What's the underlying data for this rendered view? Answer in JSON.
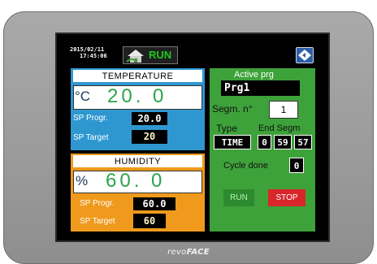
{
  "header": {
    "date": "2015/02/11",
    "time": "17:45:06",
    "status": "RUN",
    "colors": {
      "status": "#1ec81e",
      "nav": "#2d5ea8"
    }
  },
  "temperature": {
    "title": "TEMPERATURE",
    "unit": "°C",
    "value": "20. 0",
    "sp_progr_label": "SP Progr.",
    "sp_progr_value": "20.0",
    "sp_target_label": "SP Target",
    "sp_target_value": "20",
    "colors": {
      "panel": "#2f97d0",
      "value": "#2aa44a"
    }
  },
  "humidity": {
    "title": "HUMIDITY",
    "unit": "%",
    "value": "60. 0",
    "sp_progr_label": "SP Progr.",
    "sp_progr_value": "60.0",
    "sp_target_label": "SP Target",
    "sp_target_value": "60",
    "colors": {
      "panel": "#ef9a1c",
      "value": "#2aa44a"
    }
  },
  "program": {
    "title": "Active prg",
    "name": "Prg1",
    "segment_label": "Segm. n°",
    "segment_value": "1",
    "type_label": "Type",
    "type_value": "TIME",
    "end_segm_label": "End Segm",
    "end_hours": "0",
    "end_minutes": "59",
    "end_seconds": "57",
    "cycle_label": "Cycle done",
    "cycle_value": "0",
    "run_button": "RUN",
    "stop_button": "STOP",
    "colors": {
      "panel": "#3ea23a",
      "run": "#2e8a2e",
      "stop": "#d8262a"
    }
  },
  "brand": {
    "part1": "revo",
    "part2": "FACE"
  }
}
